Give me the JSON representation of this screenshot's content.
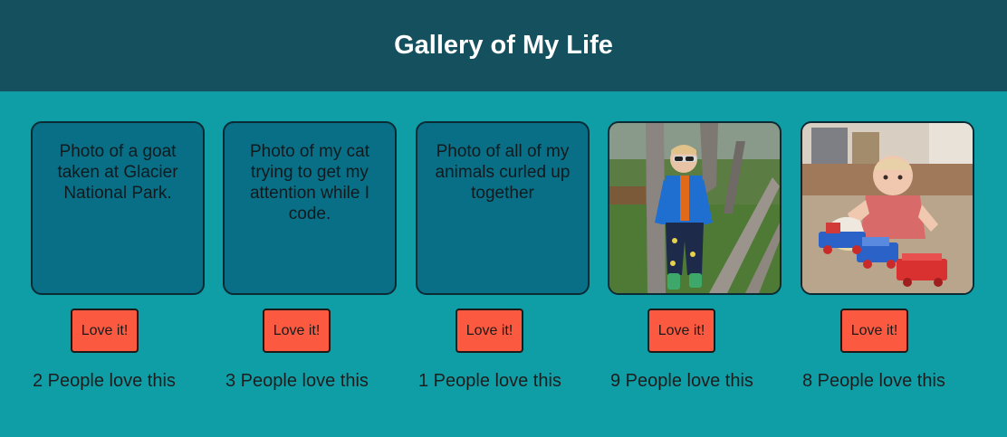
{
  "header": {
    "title": "Gallery of My Life"
  },
  "colors": {
    "page_background": "#0f9ea6",
    "header_background": "#14505d",
    "card_background": "#086f86",
    "button_background": "#fb5a40"
  },
  "gallery": {
    "items": [
      {
        "kind": "text",
        "caption": "Photo of a goat taken at Glacier National Park.",
        "button_label": "Love it!",
        "count_text": "2 People love this"
      },
      {
        "kind": "text",
        "caption": "Photo of my cat trying to get my attention while I code.",
        "button_label": "Love it!",
        "count_text": "3 People love this"
      },
      {
        "kind": "text",
        "caption": "Photo of all of my animals curled up together",
        "button_label": "Love it!",
        "count_text": "1 People love this"
      },
      {
        "kind": "image",
        "image_subject": "boy-in-sunglasses-by-tree",
        "button_label": "Love it!",
        "count_text": "9 People love this"
      },
      {
        "kind": "image",
        "image_subject": "toddler-with-toy-train",
        "button_label": "Love it!",
        "count_text": "8 People love this"
      }
    ]
  }
}
